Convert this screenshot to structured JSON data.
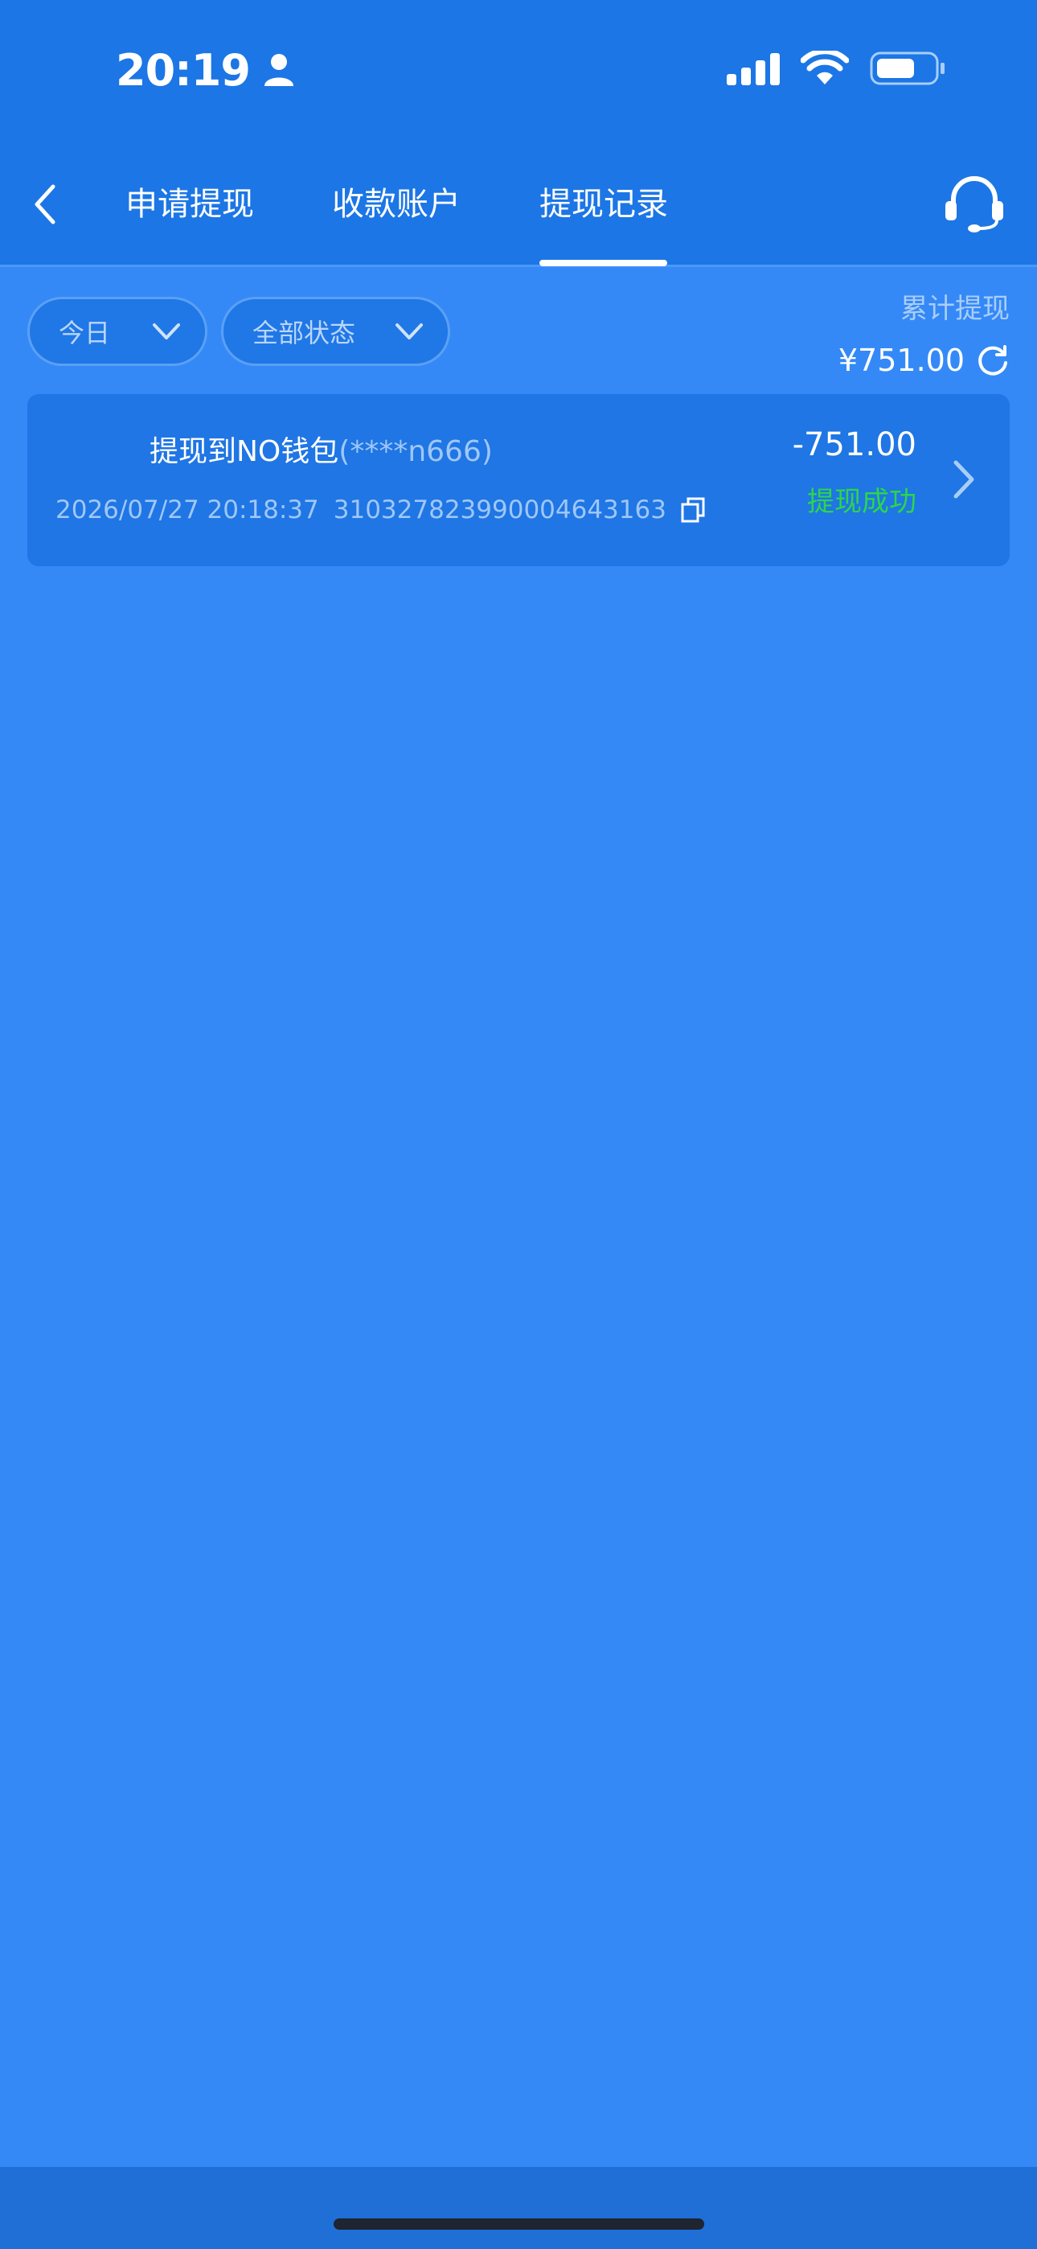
{
  "status_bar": {
    "time": "20:19"
  },
  "nav": {
    "tabs": [
      {
        "label": "申请提现"
      },
      {
        "label": "收款账户"
      },
      {
        "label": "提现记录"
      }
    ],
    "active_tab": "提现记录"
  },
  "filters": {
    "date": "今日",
    "status": "全部状态"
  },
  "summary": {
    "label": "累计提现",
    "value": "¥751.00"
  },
  "records": [
    {
      "title": "提现到NO钱包",
      "account_masked": "(****n666)",
      "datetime": "2026/07/27 20:18:37",
      "order_no": "310327823990004643163",
      "amount": "-751.00",
      "status": "提现成功"
    }
  ],
  "colors": {
    "background": "#3489f7",
    "header": "#1c76e5",
    "card": "#1f76e4",
    "success": "#2bd64a"
  },
  "icons": [
    "person-icon",
    "signal-icon",
    "wifi-icon",
    "battery-icon",
    "back-icon",
    "headset-icon",
    "chevron-down-icon",
    "refresh-icon",
    "copy-icon",
    "chevron-right-icon"
  ]
}
